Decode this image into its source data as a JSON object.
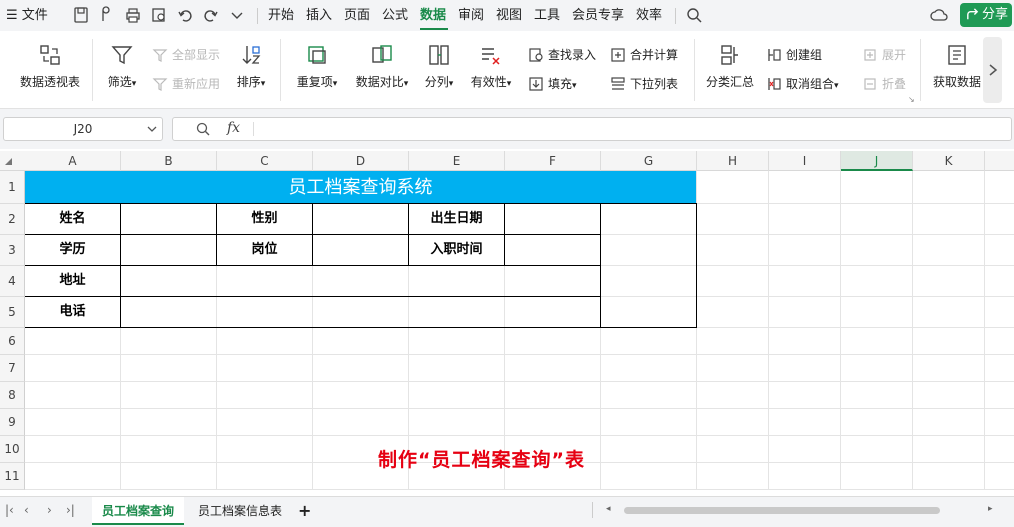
{
  "menubar": {
    "file_label": "文件",
    "items": [
      "开始",
      "插入",
      "页面",
      "公式",
      "数据",
      "审阅",
      "视图",
      "工具",
      "会员专享",
      "效率"
    ],
    "active": "数据",
    "share_label": "分享"
  },
  "ribbon": {
    "pivot": "数据透视表",
    "filter": "筛选",
    "show_all": "全部显示",
    "reapply": "重新应用",
    "sort": "排序",
    "duplicates": "重复项",
    "compare": "数据对比",
    "split": "分列",
    "validity": "有效性",
    "lookup_entry": "查找录入",
    "fill": "填充",
    "merge_calc": "合并计算",
    "dropdown_list": "下拉列表",
    "subtotal": "分类汇总",
    "create_group": "创建组",
    "ungroup": "取消组合",
    "expand": "展开",
    "collapse": "折叠",
    "get_data": "获取数据"
  },
  "formula_bar": {
    "cell_ref": "J20",
    "fx_label": "fx",
    "value": ""
  },
  "columns": [
    "A",
    "B",
    "C",
    "D",
    "E",
    "F",
    "G",
    "H",
    "I",
    "J",
    "K"
  ],
  "selected_column": "J",
  "rows": [
    "1",
    "2",
    "3",
    "4",
    "5",
    "6",
    "7",
    "8",
    "9",
    "10",
    "11"
  ],
  "sheet": {
    "title": "员工档案查询系统",
    "labels": {
      "name": "姓名",
      "gender": "性别",
      "birth_date": "出生日期",
      "education": "学历",
      "position": "岗位",
      "hire_date": "入职时间",
      "address": "地址",
      "phone": "电话"
    },
    "note": "制作“员工档案查询”表",
    "colors": {
      "title_bg": "#00b0f0",
      "note": "#e60012",
      "accent": "#1a8a4a"
    }
  },
  "tabs": [
    "员工档案查询",
    "员工档案信息表"
  ],
  "active_tab": "员工档案查询",
  "add_tab_label": "+"
}
